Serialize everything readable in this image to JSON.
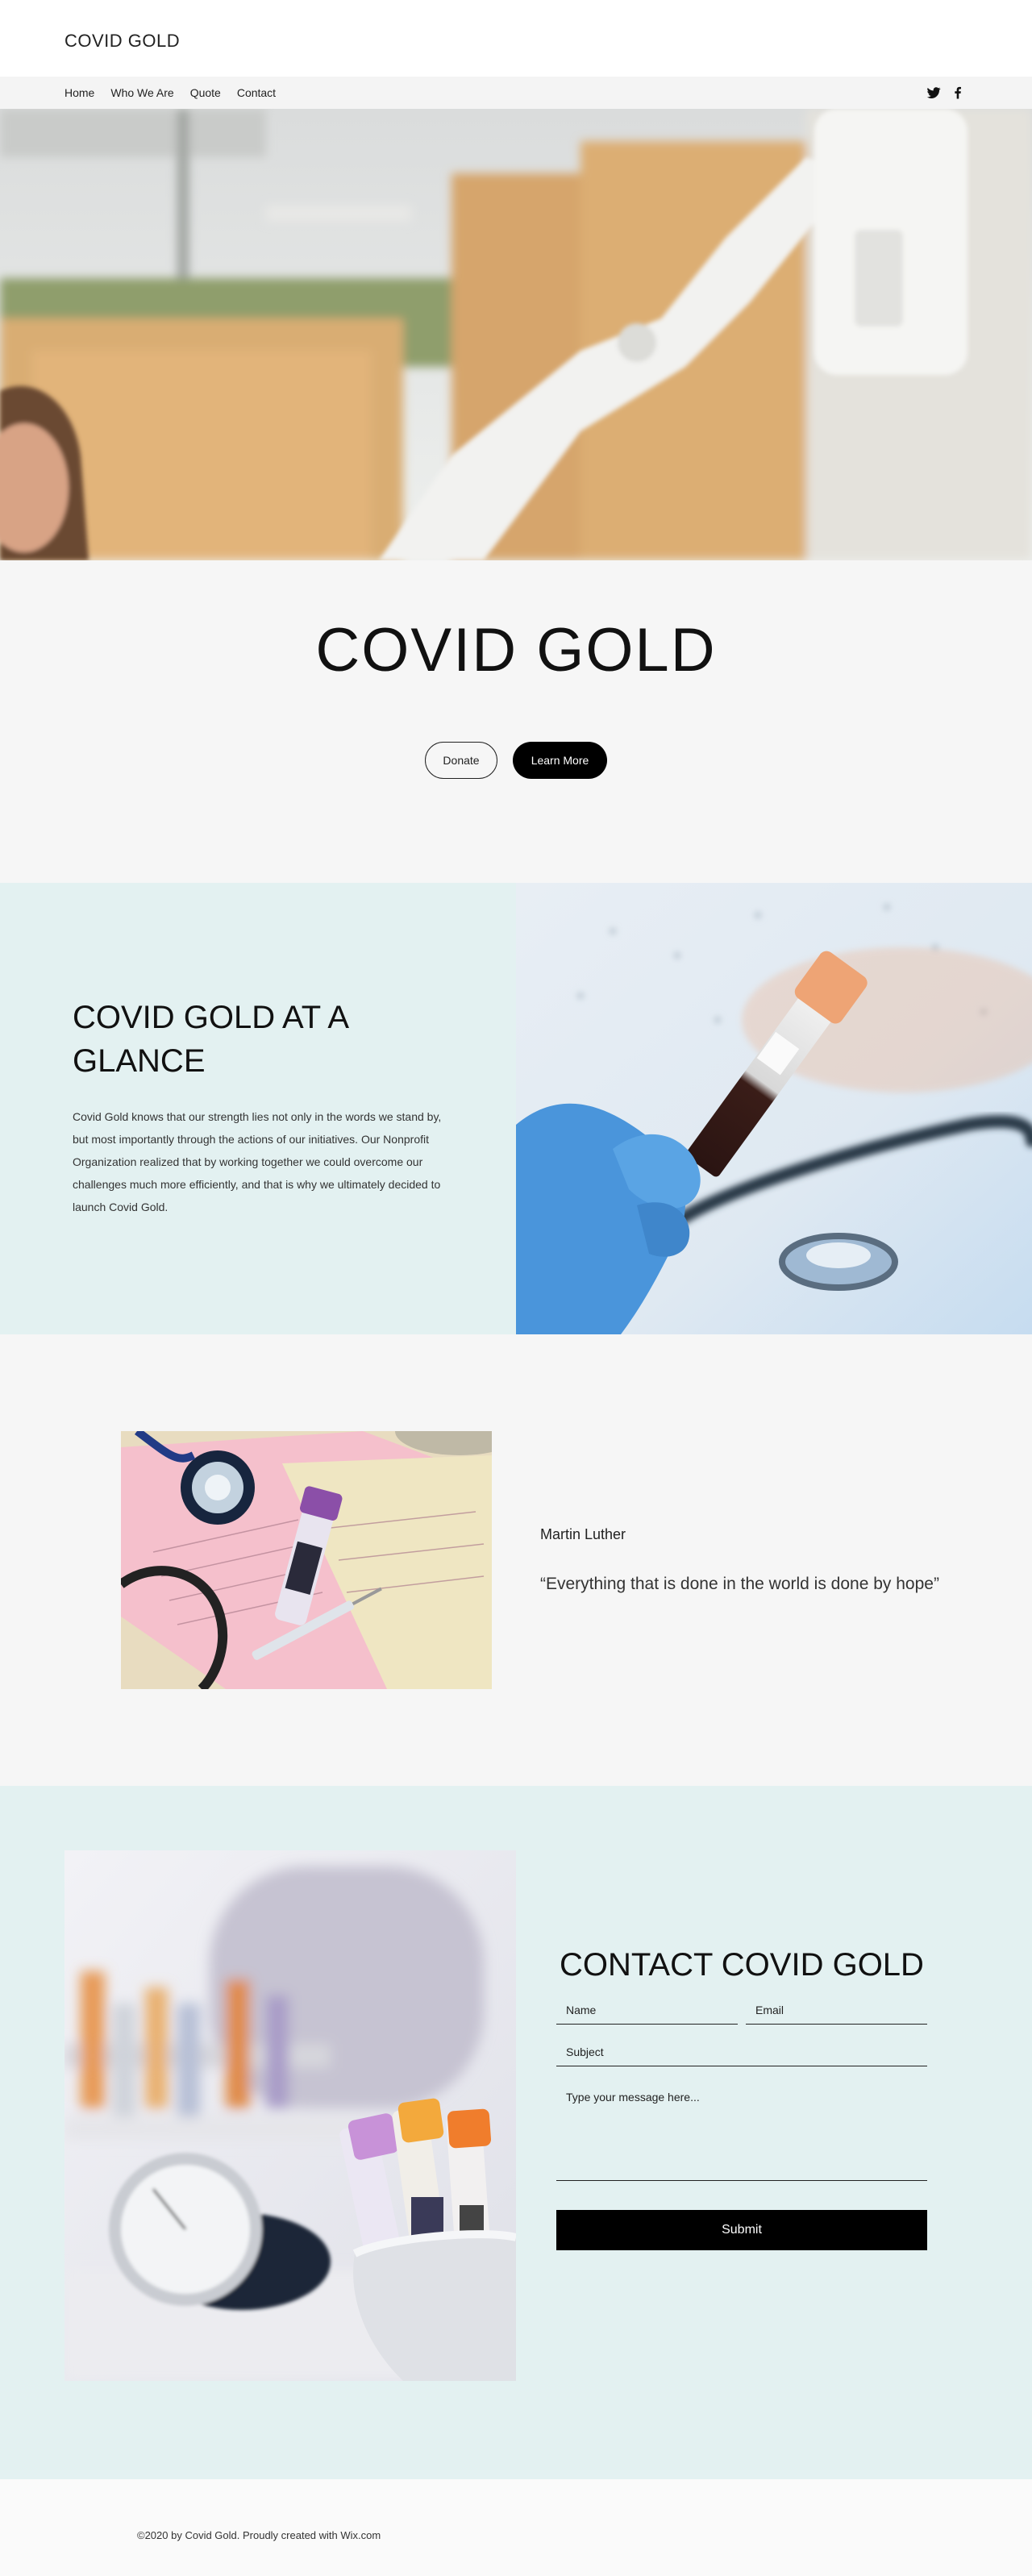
{
  "header": {
    "site_title": "COVID GOLD"
  },
  "nav": {
    "items": [
      {
        "label": "Home"
      },
      {
        "label": "Who We Are"
      },
      {
        "label": "Quote"
      },
      {
        "label": "Contact"
      }
    ],
    "social": [
      "twitter-icon",
      "facebook-icon"
    ]
  },
  "hero": {
    "title": "COVID GOLD",
    "donate_label": "Donate",
    "learn_more_label": "Learn More"
  },
  "glance": {
    "title": "COVID GOLD AT A GLANCE",
    "text": "Covid Gold knows that our strength lies not only in the words we stand by, but most importantly through the actions of our initiatives. Our Nonprofit Organization realized that by working together we could overcome our challenges much more efficiently, and that is why we ultimately decided to launch Covid Gold."
  },
  "quote": {
    "author": "Martin Luther",
    "text": "“Everything that is done in the world is done by hope”"
  },
  "contact": {
    "title": "CONTACT COVID GOLD",
    "name_placeholder": "Name",
    "email_placeholder": "Email",
    "subject_placeholder": "Subject",
    "message_placeholder": "Type your message here...",
    "submit_label": "Submit"
  },
  "footer": {
    "text": "©2020 by Covid Gold. Proudly created with Wix.com"
  },
  "colors": {
    "band": "#f6f6f6",
    "mint": "#e3f1f1",
    "accent": "#000000"
  }
}
